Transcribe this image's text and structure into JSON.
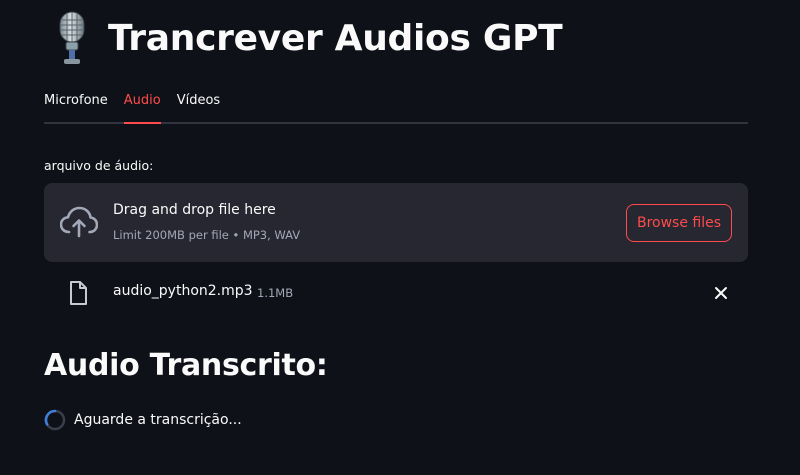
{
  "app": {
    "title_icon": "microphone-icon",
    "title": "Trancrever Audios GPT"
  },
  "tabs": [
    {
      "label": "Microfone",
      "active": false
    },
    {
      "label": "Audio",
      "active": true
    },
    {
      "label": "Vídeos",
      "active": false
    }
  ],
  "uploader": {
    "label": "arquivo de áudio:",
    "drop_text": "Drag and drop file here",
    "limit_text": "Limit 200MB per file • MP3, WAV",
    "browse_label": "Browse files",
    "upload_icon": "cloud-upload-icon"
  },
  "uploaded_file": {
    "icon": "file-icon",
    "name": "audio_python2.mp3",
    "size": "1.1MB",
    "remove_icon": "close-icon"
  },
  "result": {
    "heading": "Audio Transcrito:",
    "status_text": "Aguarde a transcrição..."
  },
  "colors": {
    "background": "#0e1117",
    "surface": "#262730",
    "accent": "#ff4b4b",
    "text": "#fafafa",
    "muted": "#a3a8b8"
  }
}
